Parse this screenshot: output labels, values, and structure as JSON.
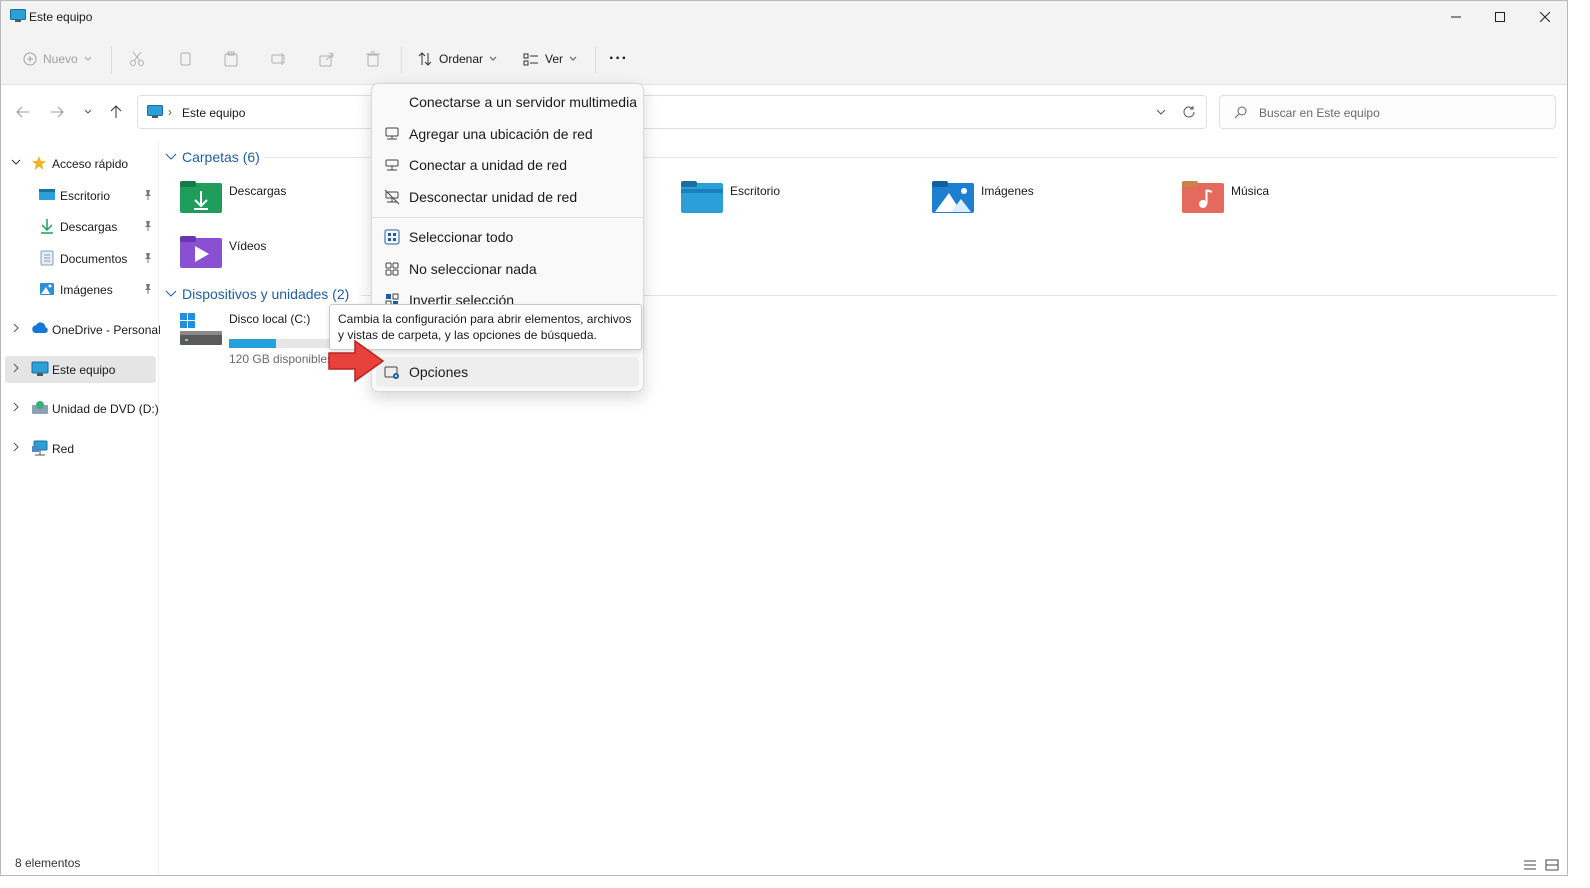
{
  "window": {
    "title": "Este equipo"
  },
  "toolbar": {
    "new_label": "Nuevo",
    "sort_label": "Ordenar",
    "view_label": "Ver",
    "more_label": "···"
  },
  "address": {
    "crumb": "Este equipo"
  },
  "search": {
    "placeholder": "Buscar en Este equipo"
  },
  "sidebar": {
    "items": [
      {
        "label": "Acceso rápido",
        "icon": "star-icon"
      },
      {
        "label": "Escritorio",
        "icon": "desktop-folder-icon",
        "pinned": true
      },
      {
        "label": "Descargas",
        "icon": "download-icon",
        "pinned": true
      },
      {
        "label": "Documentos",
        "icon": "document-icon",
        "pinned": true
      },
      {
        "label": "Imágenes",
        "icon": "image-icon",
        "pinned": true
      },
      {
        "label": "OneDrive - Personal",
        "icon": "cloud-icon"
      },
      {
        "label": "Este equipo",
        "icon": "computer-icon",
        "selected": true
      },
      {
        "label": "Unidad de DVD (D:)",
        "icon": "dvd-icon"
      },
      {
        "label": "Red",
        "icon": "network-icon"
      }
    ]
  },
  "content": {
    "folders_header": "Carpetas (6)",
    "folders": [
      {
        "label": "Descargas"
      },
      {
        "label": "Escritorio"
      },
      {
        "label": "Imágenes"
      },
      {
        "label": "Música"
      },
      {
        "label": "Vídeos"
      }
    ],
    "devices_header": "Dispositivos y unidades (2)",
    "drive": {
      "label": "Disco local (C:)",
      "free": "120 GB disponibles",
      "used_fraction": 0.43
    }
  },
  "menu": {
    "items": [
      {
        "label": "Conectarse a un servidor multimedia"
      },
      {
        "label": "Agregar una ubicación de red"
      },
      {
        "label": "Conectar a unidad de red"
      },
      {
        "label": "Desconectar unidad de red"
      },
      {
        "label": "Seleccionar todo"
      },
      {
        "label": "No seleccionar nada"
      },
      {
        "label": "Invertir selección"
      },
      {
        "label": "Opciones"
      }
    ]
  },
  "tooltip": {
    "text": "Cambia la configuración para abrir elementos, archivos y vistas de carpeta, y las opciones de búsqueda."
  },
  "status": {
    "count": "8 elementos"
  },
  "colors": {
    "accent": "#1d5fa8",
    "selected_bg": "#e5e5e5",
    "arrow": "#e8403a"
  }
}
